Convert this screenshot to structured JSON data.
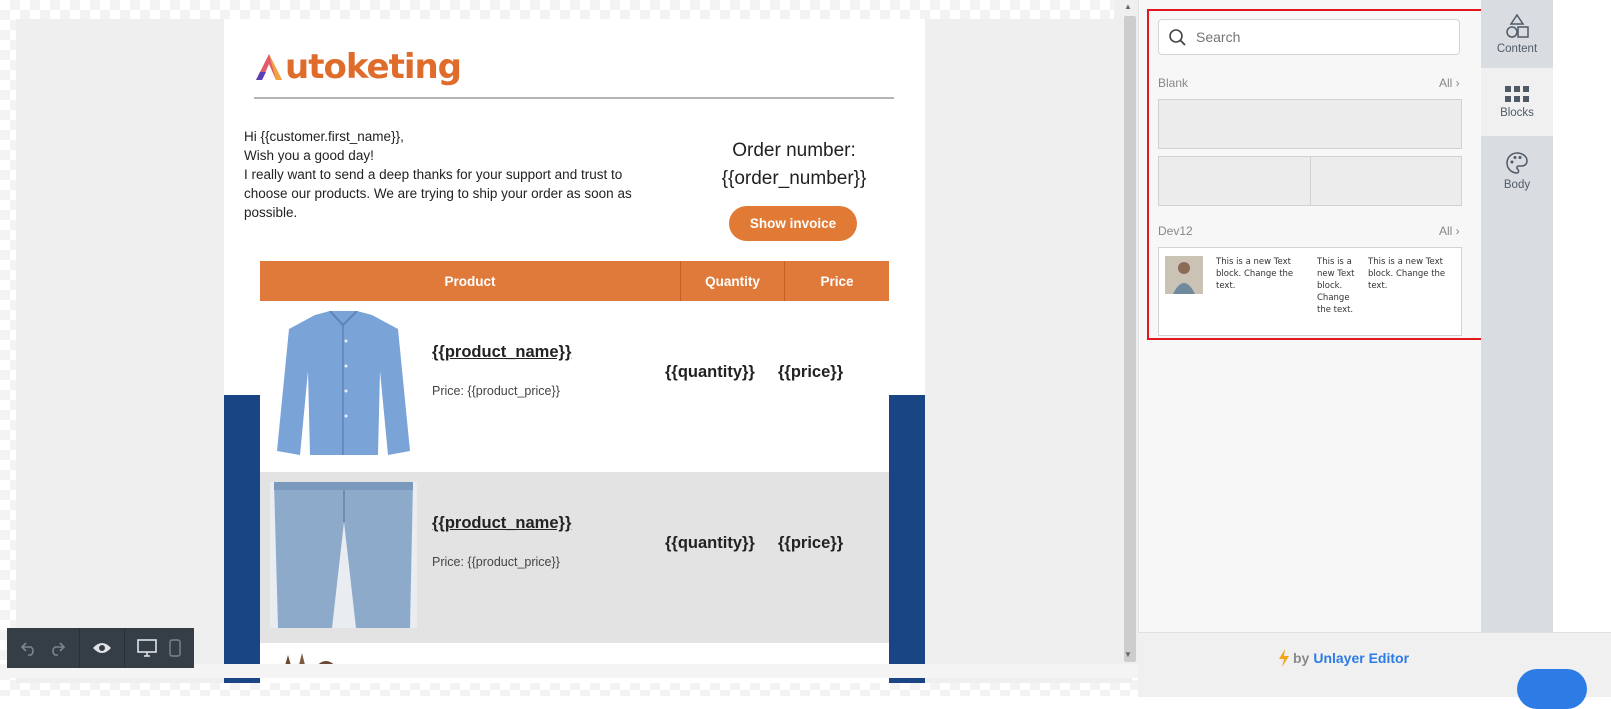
{
  "email": {
    "logo_text": "utoketing",
    "greeting_lines": [
      "Hi {{customer.first_name}},",
      "Wish you a good day!",
      "I really want to send a deep thanks for your support and trust to choose our products. We are trying to ship your order as soon as possible."
    ],
    "order_label": "Order number:",
    "order_value": "{{order_number}}",
    "invoice_button": "Show invoice",
    "table_headers": {
      "product": "Product",
      "quantity": "Quantity",
      "price": "Price"
    },
    "rows": [
      {
        "name": "{{product_name}}",
        "price": "Price: {{product_price}}",
        "quantity": "{{quantity}}",
        "total": "{{price}}"
      },
      {
        "name": "{{product_name}}",
        "price": "Price: {{product_price}}",
        "quantity": "{{quantity}}",
        "total": "{{price}}"
      }
    ],
    "colors": {
      "brand": "#e07a3a",
      "accent_blue": "#1a4584"
    }
  },
  "panel": {
    "search_placeholder": "Search",
    "blank_label": "Blank",
    "blank_all": "All ›",
    "dev_label": "Dev12",
    "dev_all": "All ›",
    "dev_texts": [
      "This is a new Text block. Change the text.",
      "This is a new Text block. Change the text.",
      "This is a new Text block. Change the text."
    ]
  },
  "tabs": [
    {
      "label": "Content",
      "icon": "shapes-icon"
    },
    {
      "label": "Blocks",
      "icon": "grid-icon"
    },
    {
      "label": "Body",
      "icon": "palette-icon"
    }
  ],
  "footer": {
    "by": "by",
    "brand": "Unlayer Editor"
  },
  "toolbar": {
    "icons": [
      "undo-icon",
      "redo-icon",
      "preview-icon",
      "desktop-icon",
      "mobile-icon"
    ]
  }
}
